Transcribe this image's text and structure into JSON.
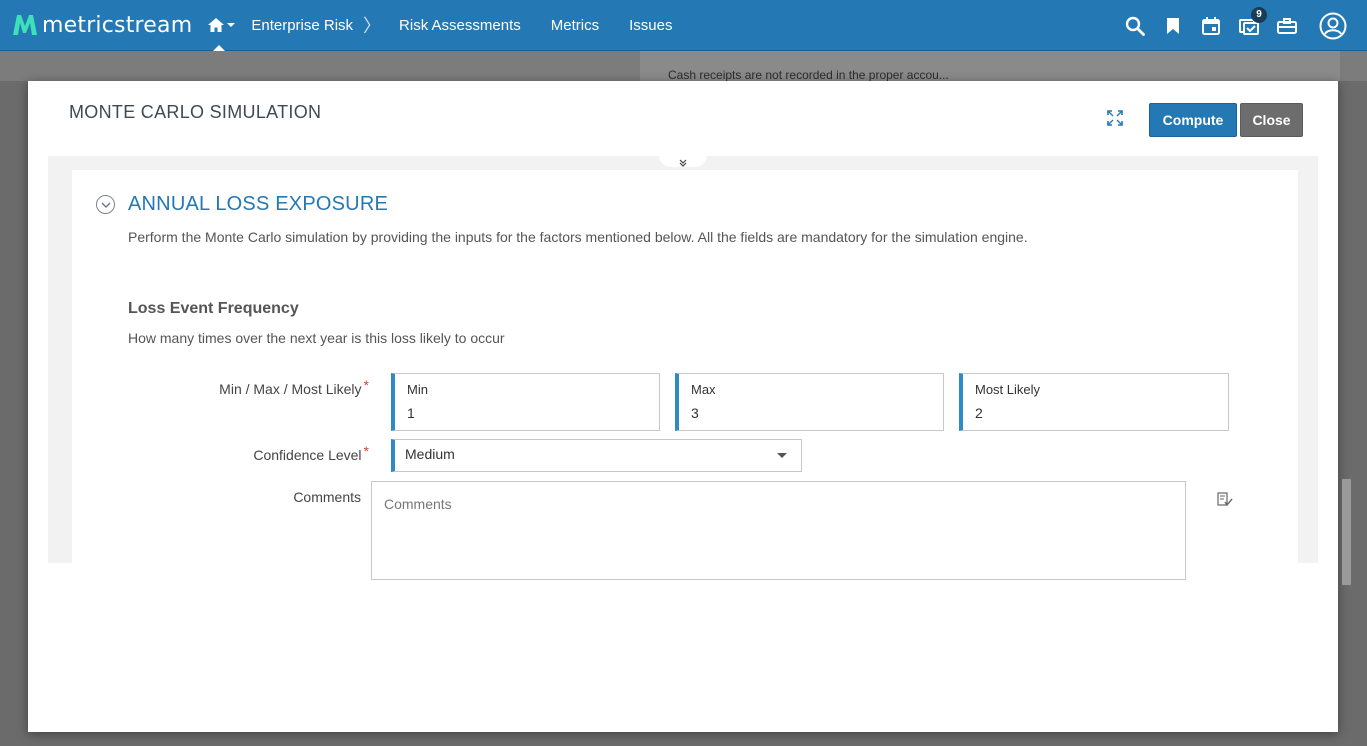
{
  "topbar": {
    "brand": "metricstream",
    "nav": [
      {
        "label": "Enterprise Risk"
      },
      {
        "label": "Risk Assessments"
      },
      {
        "label": "Metrics"
      },
      {
        "label": "Issues"
      }
    ],
    "notification_count": "9",
    "colors": {
      "bar": "#2478b4",
      "text": "#ffffff"
    }
  },
  "background": {
    "row_text": "Cash receipts are not recorded in the proper accou..."
  },
  "modal": {
    "title": "MONTE CARLO SIMULATION",
    "compute_label": "Compute",
    "close_label": "Close",
    "section": {
      "title": "ANNUAL LOSS EXPOSURE",
      "description": "Perform the Monte Carlo simulation by providing the inputs for the factors mentioned below. All the fields are mandatory for the simulation engine."
    },
    "subsection": {
      "title": "Loss Event Frequency",
      "description": "How many times over the next year is this loss likely to occur"
    },
    "fields": {
      "range_label": "Min / Max / Most Likely",
      "min": {
        "label": "Min",
        "value": "1"
      },
      "max": {
        "label": "Max",
        "value": "3"
      },
      "most_likely": {
        "label": "Most Likely",
        "value": "2"
      },
      "confidence_label": "Confidence Level",
      "confidence_value": "Medium",
      "comments_label": "Comments",
      "comments_placeholder": "Comments",
      "required_mark": "*"
    }
  }
}
